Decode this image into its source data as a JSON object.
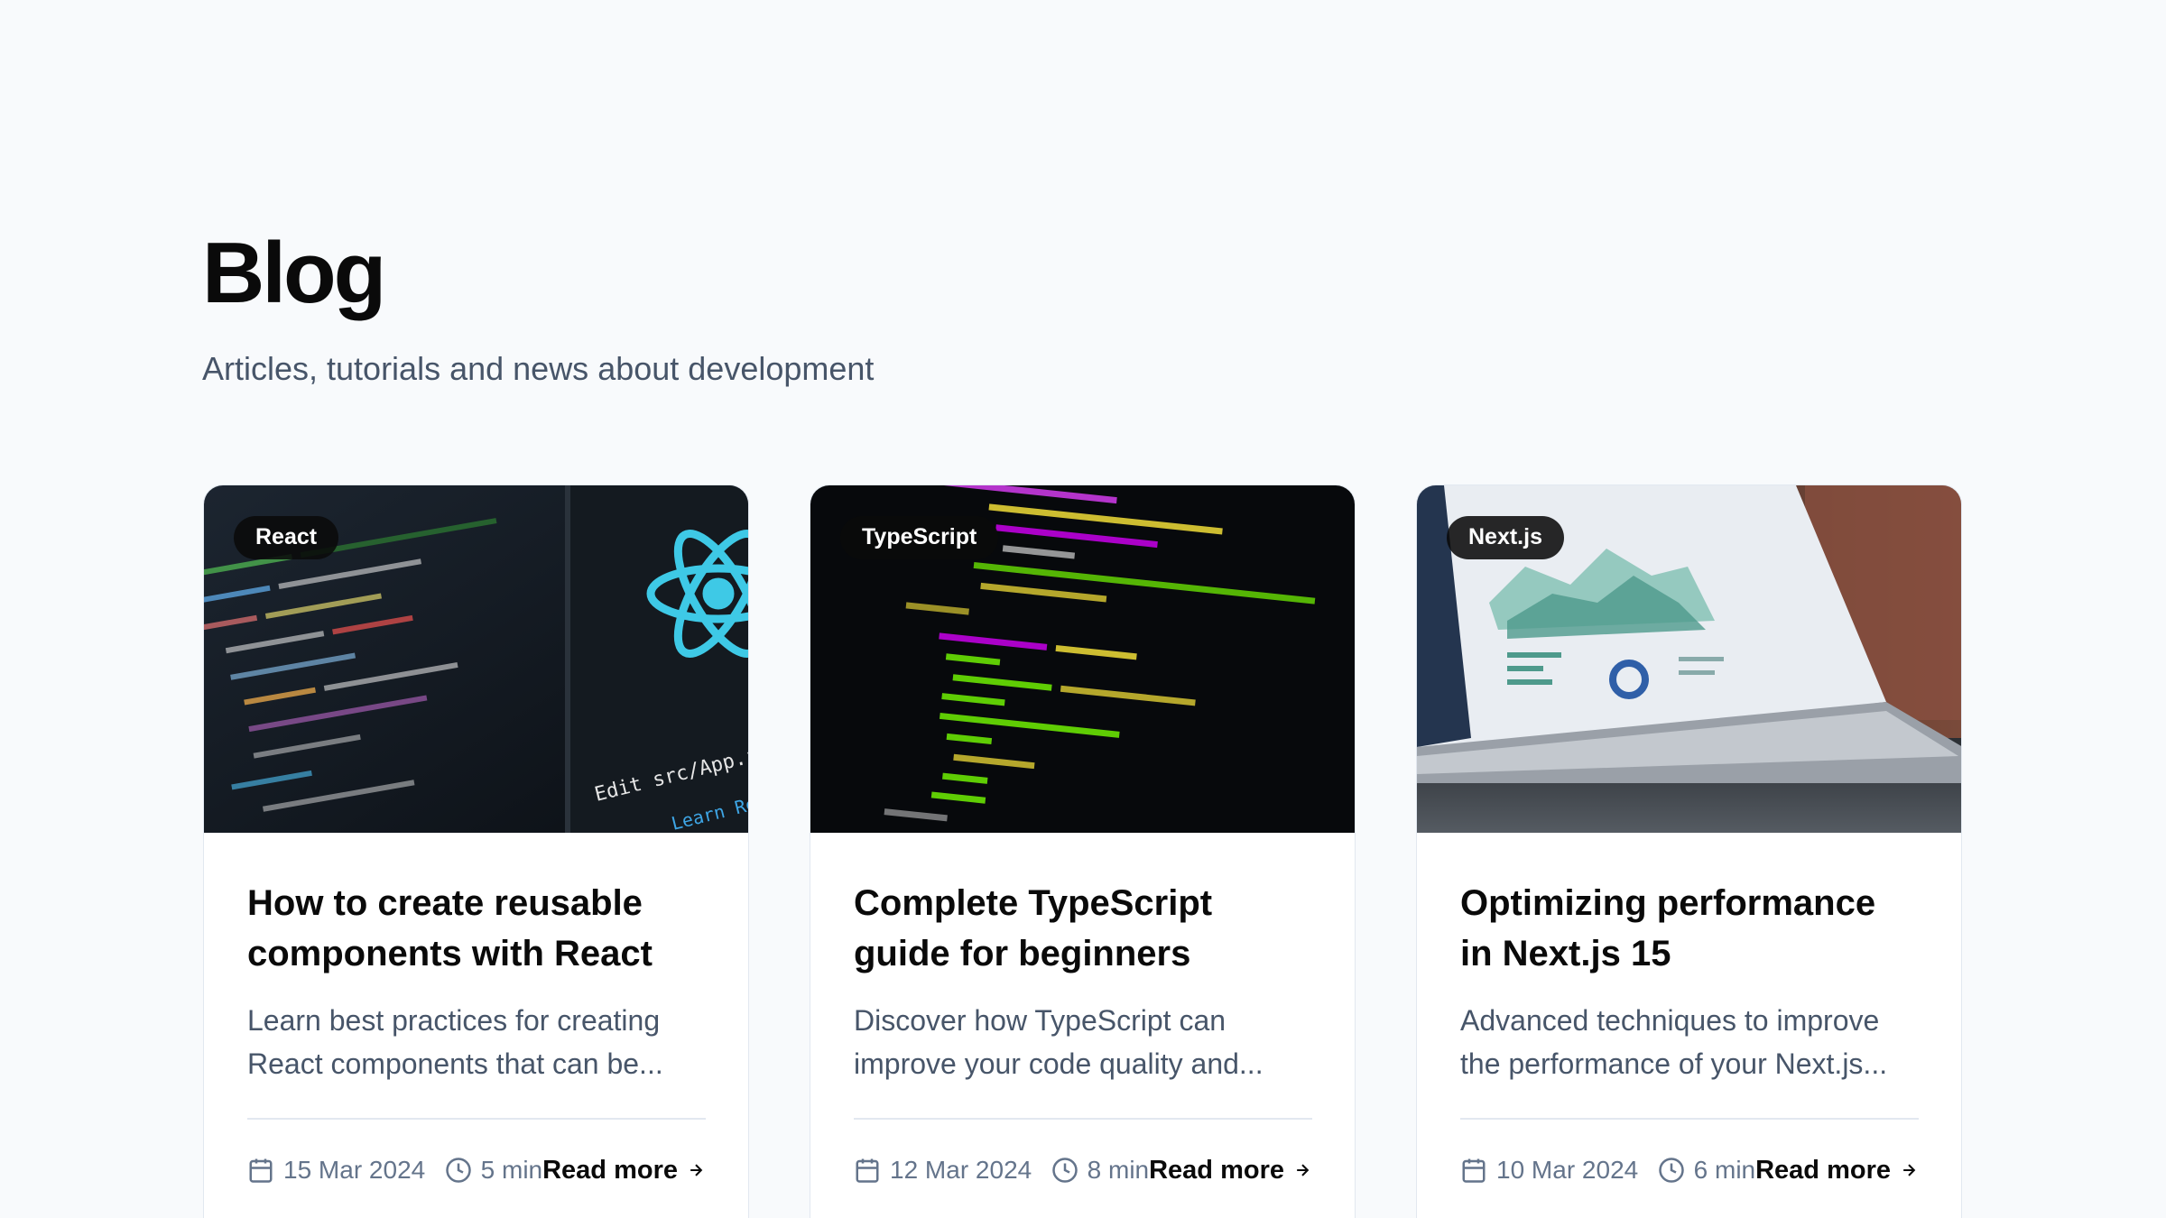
{
  "header": {
    "title": "Blog",
    "subtitle": "Articles, tutorials and news about development"
  },
  "posts": [
    {
      "tag": "React",
      "title": "How to create reusable components with React",
      "excerpt": "Learn best practices for creating React components that can be...",
      "date": "15 Mar 2024",
      "read_time": "5 min",
      "read_more": "Read more",
      "image": "react-code-editor-with-logo"
    },
    {
      "tag": "TypeScript",
      "title": "Complete TypeScript guide for beginners",
      "excerpt": "Discover how TypeScript can improve your code quality and...",
      "date": "12 Mar 2024",
      "read_time": "8 min",
      "read_more": "Read more",
      "image": "colorful-code-on-dark-screen"
    },
    {
      "tag": "Next.js",
      "title": "Optimizing performance in Next.js 15",
      "excerpt": "Advanced techniques to improve the performance of your Next.js...",
      "date": "10 Mar 2024",
      "read_time": "6 min",
      "read_more": "Read more",
      "image": "laptop-analytics-dashboard"
    }
  ],
  "colors": {
    "background": "#f8fafc",
    "card": "#ffffff",
    "tag_bg": "#0a0a0a",
    "muted_text": "#475569"
  }
}
